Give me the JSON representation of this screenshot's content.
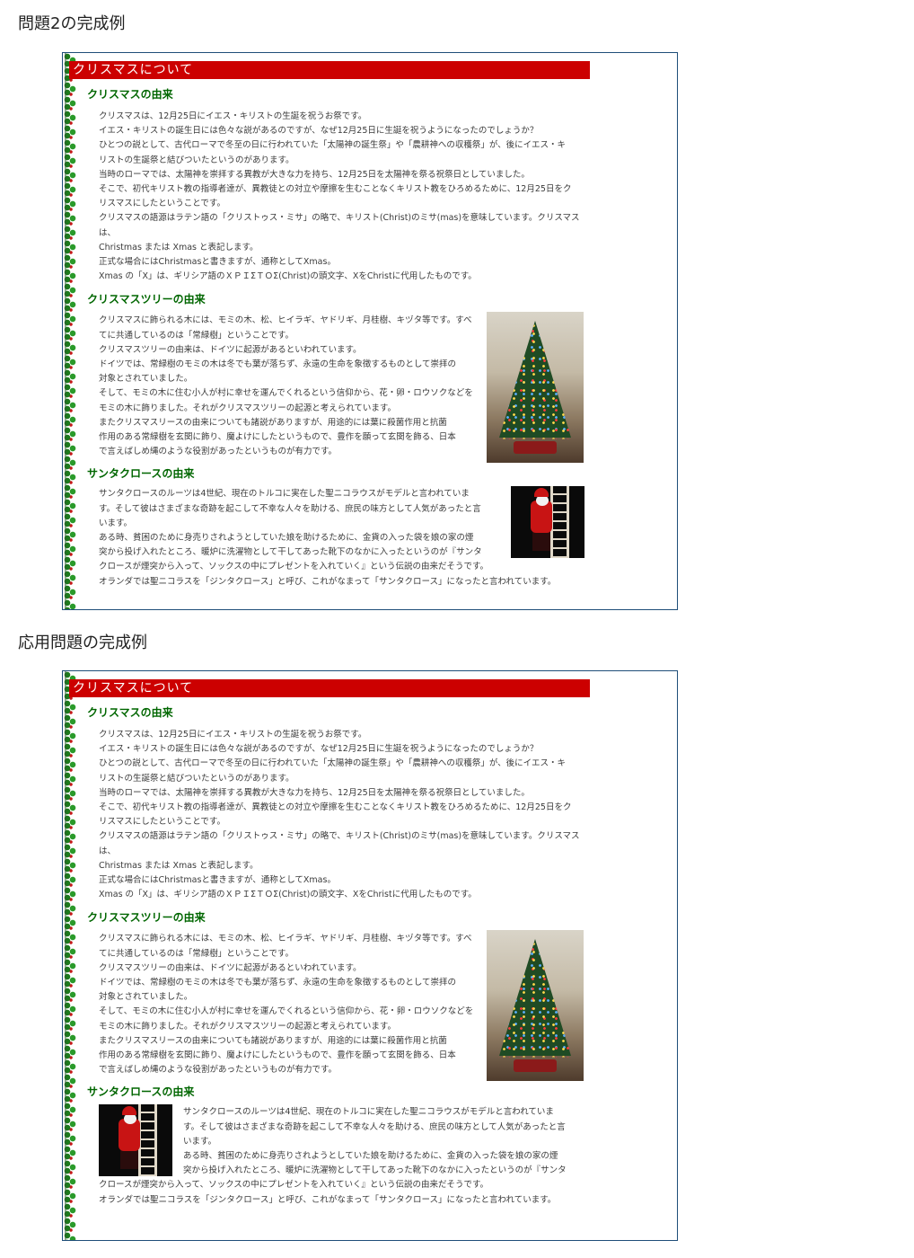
{
  "headings": {
    "example1": "問題2の完成例",
    "example2": "応用問題の完成例"
  },
  "banner": "クリスマスについて",
  "sections": {
    "origin": {
      "title": "クリスマスの由来",
      "lines": [
        "クリスマスは、12月25日にイエス・キリストの生誕を祝うお祭です。",
        "イエス・キリストの誕生日には色々な説があるのですが、なぜ12月25日に生誕を祝うようになったのでしょうか？",
        "ひとつの説として、古代ローマで冬至の日に行われていた「太陽神の誕生祭」や「農耕神への収穫祭」が、後にイエス・キ",
        "リストの生誕祭と結びついたというのがあります。",
        "当時のローマでは、太陽神を崇拝する異教が大きな力を持ち、12月25日を太陽神を祭る祝祭日としていました。",
        "そこで、初代キリスト教の指導者達が、異教徒との対立や摩擦を生むことなくキリスト教をひろめるために、12月25日をク",
        "リスマスにしたということです。",
        "クリスマスの語源はラテン語の「クリストゥス・ミサ」の略で、キリスト(Christ)のミサ(mas)を意味しています。クリスマスは、",
        "Christmas または Xmas と表記します。",
        "正式な場合にはChristmasと書きますが、通称としてXmas。",
        "Xmas の「X」は、ギリシア語のＸＰＩΣＴＯΣ(Christ)の頭文字、XをChristに代用したものです。"
      ]
    },
    "tree": {
      "title": "クリスマスツリーの由来",
      "lines": [
        "クリスマスに飾られる木には、モミの木、松、ヒイラギ、ヤドリギ、月桂樹、キヅタ等です。すべ",
        "てに共通しているのは「常緑樹」ということです。",
        "クリスマスツリーの由来は、ドイツに起源があるといわれています。",
        "ドイツでは、常緑樹のモミの木は冬でも葉が落ちず、永遠の生命を象徴するものとして崇拝の",
        "対象とされていました。",
        "そして、モミの木に住む小人が村に幸せを運んでくれるという信仰から、花・卵・ロウソクなどを",
        "モミの木に飾りました。それがクリスマスツリーの起源と考えられています。",
        "またクリスマスリースの由来についても諸説がありますが、用途的には葉に殺菌作用と抗菌",
        "作用のある常緑樹を玄関に飾り、魔よけにしたというもので、豊作を願って玄関を飾る、日本",
        "で言えばしめ縄のような役割があったというものが有力です。"
      ]
    },
    "santa": {
      "title": "サンタクロースの由来",
      "lines": [
        "サンタクロースのルーツは4世紀、現在のトルコに実在した聖ニコラウスがモデルと言われていま",
        "す。そして彼はさまざまな奇跡を起こして不幸な人々を助ける、庶民の味方として人気があったと言",
        "います。",
        "ある時、貧困のために身売りされようとしていた娘を助けるために、金貨の入った袋を娘の家の煙",
        "突から投げ入れたところ、暖炉に洗濯物として干してあった靴下のなかに入ったというのが『サンタ",
        "クロースが煙突から入って、ソックスの中にプレゼントを入れていく』という伝説の由来だそうです。",
        "オランダでは聖ニコラスを「ジンタクロース」と呼び、これがなまって「サンタクロース」になったと言われています。"
      ]
    }
  },
  "colors": {
    "banner": "#cc0000",
    "section_title": "#006600",
    "frame_border": "#1f4e79"
  },
  "icons": {
    "border": "holly-vine-border",
    "tree": "christmas-tree-photo",
    "santa": "santa-on-ladder-photo"
  }
}
